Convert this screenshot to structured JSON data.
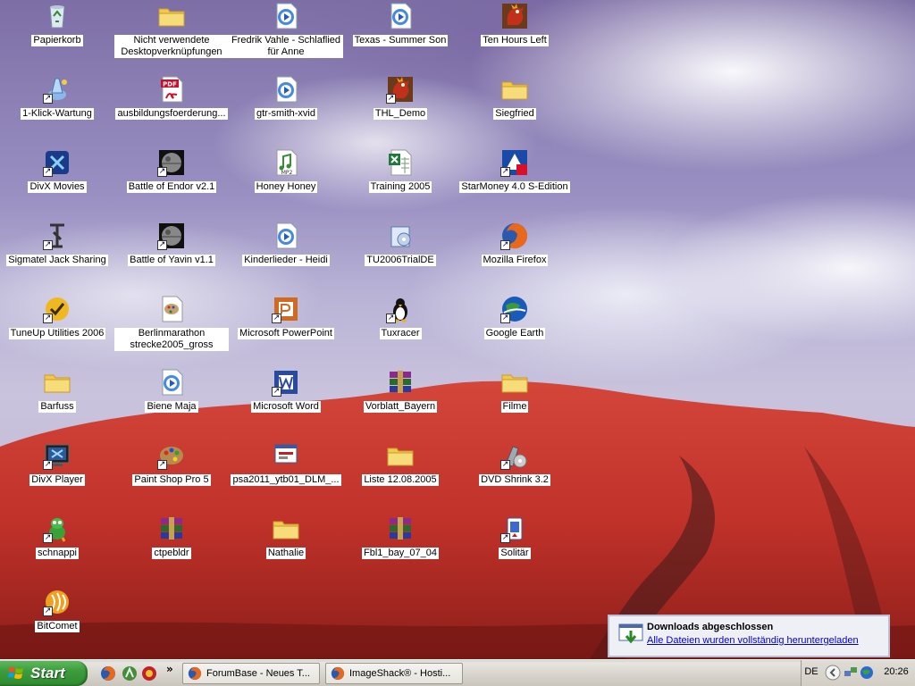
{
  "desktop": {
    "icons": [
      {
        "label": "Papierkorb",
        "icon": "recycle-bin-icon"
      },
      {
        "label": "Nicht verwendete Desktopverknüpfungen",
        "icon": "folder-icon"
      },
      {
        "label": "Fredrik Vahle - Schlaflied für Anne",
        "icon": "media-player-file-icon"
      },
      {
        "label": "Texas - Summer Son",
        "icon": "media-player-file-icon"
      },
      {
        "label": "Ten Hours Left",
        "icon": "rooster-game-icon"
      },
      {
        "label": "1-Klick-Wartung",
        "icon": "cleanup-wizard-icon"
      },
      {
        "label": "ausbildungsfoerderung...",
        "icon": "pdf-icon"
      },
      {
        "label": "gtr-smith-xvid",
        "icon": "media-player-file-icon"
      },
      {
        "label": "THL_Demo",
        "icon": "rooster-game-icon"
      },
      {
        "label": "Siegfried",
        "icon": "folder-icon"
      },
      {
        "label": "DivX Movies",
        "icon": "divx-icon"
      },
      {
        "label": "Battle of Endor v2.1",
        "icon": "death-star-icon"
      },
      {
        "label": "Honey Honey",
        "icon": "mp2-file-icon"
      },
      {
        "label": "Training 2005",
        "icon": "excel-file-icon"
      },
      {
        "label": "StarMoney 4.0 S-Edition",
        "icon": "starmoney-icon"
      },
      {
        "label": "Sigmatel Jack Sharing",
        "icon": "audio-jack-icon"
      },
      {
        "label": "Battle of Yavin v1.1",
        "icon": "death-star-icon"
      },
      {
        "label": "Kinderlieder - Heidi",
        "icon": "media-player-file-icon"
      },
      {
        "label": "TU2006TrialDE",
        "icon": "installer-icon"
      },
      {
        "label": "Mozilla Firefox",
        "icon": "firefox-icon"
      },
      {
        "label": "TuneUp Utilities 2006",
        "icon": "tuneup-icon"
      },
      {
        "label": "Berlinmarathon strecke2005_gross",
        "icon": "paint-shop-file-icon"
      },
      {
        "label": "Microsoft PowerPoint",
        "icon": "powerpoint-icon"
      },
      {
        "label": "Tuxracer",
        "icon": "penguin-icon"
      },
      {
        "label": "Google Earth",
        "icon": "google-earth-icon"
      },
      {
        "label": "Barfuss",
        "icon": "folder-icon"
      },
      {
        "label": "Biene Maja",
        "icon": "media-player-file-icon"
      },
      {
        "label": "Microsoft Word",
        "icon": "word-icon"
      },
      {
        "label": "Vorblatt_Bayern",
        "icon": "winrar-archive-icon"
      },
      {
        "label": "Filme",
        "icon": "folder-icon"
      },
      {
        "label": "DivX Player",
        "icon": "divx-player-icon"
      },
      {
        "label": "Paint Shop Pro 5",
        "icon": "paint-shop-icon"
      },
      {
        "label": "psa2011_ytb01_DLM_...",
        "icon": "setup-program-icon"
      },
      {
        "label": "Liste 12.08.2005",
        "icon": "folder-icon"
      },
      {
        "label": "DVD Shrink 3.2",
        "icon": "dvd-shrink-icon"
      },
      {
        "label": "schnappi",
        "icon": "crocodile-icon"
      },
      {
        "label": "ctpebldr",
        "icon": "winrar-archive-icon"
      },
      {
        "label": "Nathalie",
        "icon": "folder-icon"
      },
      {
        "label": "Fbl1_bay_07_04",
        "icon": "winrar-archive-icon"
      },
      {
        "label": "Solitär",
        "icon": "solitaire-icon"
      },
      {
        "label": "BitComet",
        "icon": "bitcomet-icon"
      }
    ]
  },
  "taskbar": {
    "start_label": "Start",
    "quicklaunch": [
      "firefox-icon",
      "winamp-icon",
      "media-icon"
    ],
    "chevron": "»",
    "tasks": [
      {
        "label": "ForumBase - Neues T...",
        "icon": "firefox-icon"
      },
      {
        "label": "ImageShack® - Hosti...",
        "icon": "firefox-icon"
      }
    ],
    "tray": {
      "language": "DE",
      "time": "20:26"
    }
  },
  "balloon": {
    "title": "Downloads abgeschlossen",
    "message": "Alle Dateien wurden vollständig heruntergeladen"
  },
  "colors": {
    "start_green": "#3c9c3c",
    "link_blue": "#0000cc",
    "rock_red": "#c2322a"
  }
}
